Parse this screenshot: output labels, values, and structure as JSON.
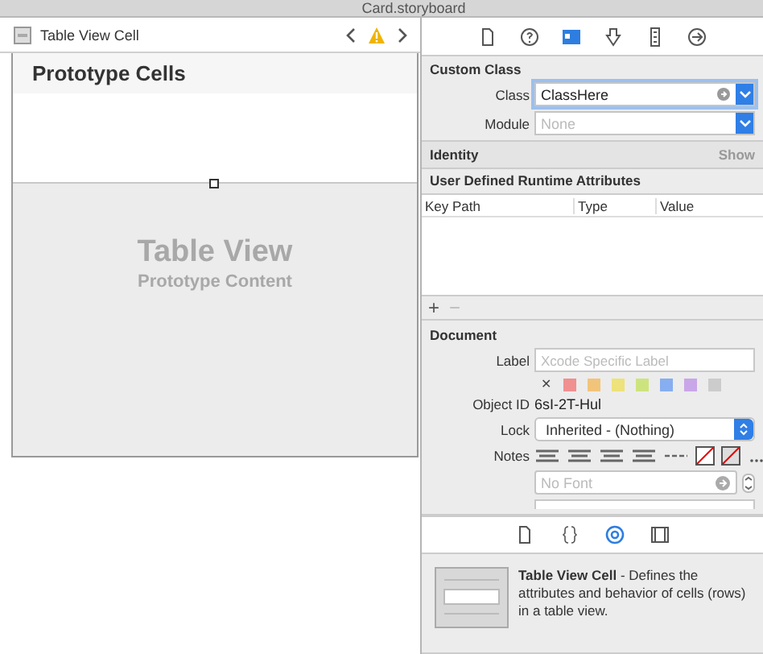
{
  "window": {
    "title": "Card.storyboard"
  },
  "breadcrumb": {
    "item": "Table View Cell"
  },
  "canvas": {
    "section_header": "Prototype Cells",
    "placeholder_title": "Table View",
    "placeholder_subtitle": "Prototype Content"
  },
  "inspector_tabs": [
    {
      "kind": "file",
      "selected": false
    },
    {
      "kind": "help",
      "selected": false
    },
    {
      "kind": "identity",
      "selected": true
    },
    {
      "kind": "attributes",
      "selected": false
    },
    {
      "kind": "size",
      "selected": false
    },
    {
      "kind": "connections",
      "selected": false
    }
  ],
  "custom_class": {
    "title": "Custom Class",
    "class_label": "Class",
    "class_value": "ClassHere",
    "module_label": "Module",
    "module_placeholder": "None"
  },
  "identity": {
    "title": "Identity",
    "action": "Show"
  },
  "runtime_attributes": {
    "title": "User Defined Runtime Attributes",
    "columns": [
      "Key Path",
      "Type",
      "Value"
    ],
    "add": "+",
    "remove": "−"
  },
  "document": {
    "title": "Document",
    "label_label": "Label",
    "label_placeholder": "Xcode Specific Label",
    "clear_mark": "✕",
    "label_colors": [
      {
        "color": "#f09090"
      },
      {
        "color": "#f2c47a"
      },
      {
        "color": "#eee27a"
      },
      {
        "color": "#cde47e"
      },
      {
        "color": "#86aef0"
      },
      {
        "color": "#c9a6e8"
      },
      {
        "color": "#cccccc"
      }
    ],
    "object_id_label": "Object ID",
    "object_id": "6sI-2T-Hul",
    "lock_label": "Lock",
    "lock_value": "Inherited - (Nothing)",
    "notes_label": "Notes",
    "font_placeholder": "No Font"
  },
  "library_tabs": [
    {
      "kind": "file",
      "selected": false
    },
    {
      "kind": "code",
      "selected": false
    },
    {
      "kind": "object",
      "selected": true
    },
    {
      "kind": "media",
      "selected": false
    }
  ],
  "description": "**Table View Cell** - Defines the attributes and behavior of cells (rows) in a table view."
}
